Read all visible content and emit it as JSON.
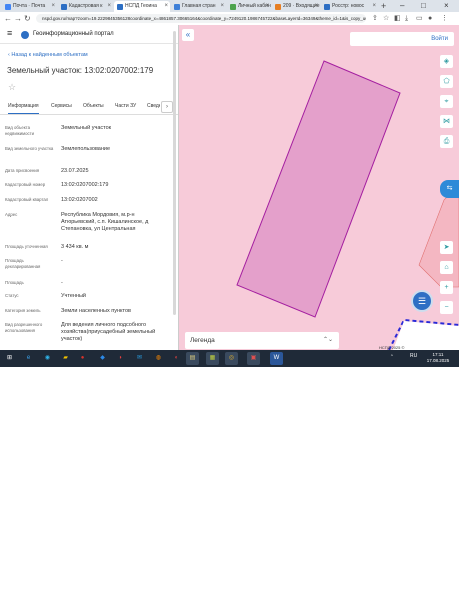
{
  "browser": {
    "tabs": [
      {
        "title": "Почта · Почта",
        "color": "#4285f4"
      },
      {
        "title": "Кадастровая к",
        "color": "#2d6fc4"
      },
      {
        "title": "НСПД Геоина",
        "color": "#2d6fc4"
      },
      {
        "title": "Главная стран",
        "color": "#3d7fd8"
      },
      {
        "title": "Личный кабин",
        "color": "#4da34d"
      },
      {
        "title": "209 · Входящие",
        "color": "#e67e22"
      },
      {
        "title": "Росстр: новос",
        "color": "#2d6fc4"
      }
    ],
    "new_tab": "+",
    "url": "nspd.gov.ru/map?zoom=19.2229845356128coordinate_x=4861857.30665164&coordinate_y=7249120.1986745722&baseLayerId=36349&theme_id=1&is_copy_url=true"
  },
  "portal": {
    "title": "Геоинформационный портал",
    "back_link": "Назад к найденным объектам",
    "heading": "Земельный участок: 13:02:0207002:179",
    "tabs": [
      "Информация",
      "Сервисы",
      "Объекты",
      "Части ЗУ",
      "Сведения"
    ],
    "next_tab": "›",
    "fields": [
      {
        "label": "Вид объекта недвижимости",
        "value": "Земельный участок"
      },
      {
        "label": "Вид земельного участка",
        "value": "Землепользование"
      },
      {
        "label": "Дата присвоения",
        "value": "23.07.2025"
      },
      {
        "label": "Кадастровый номер",
        "value": "13:02:0207002:179"
      },
      {
        "label": "Кадастровый квартал",
        "value": "13:02:0207002"
      },
      {
        "label": "Адрес",
        "value": "Республика Мордовия, м.р-н Атюрьевский, с.п. Кишалинское, д Степановка, ул Центральная"
      },
      {
        "label": "Площадь уточненная",
        "value": "3 434 кв. м"
      },
      {
        "label": "Площадь декларированная",
        "value": "-"
      },
      {
        "label": "Площадь",
        "value": "-"
      },
      {
        "label": "Статус",
        "value": "Учтенный"
      },
      {
        "label": "Категория земель",
        "value": "Земли населенных пунктов"
      },
      {
        "label": "Вид разрешенного использования",
        "value": "Для ведения личного подсобного хозяйства(приусадебный земельный участок)"
      }
    ]
  },
  "map": {
    "collapse_icon": "«",
    "login": "Войти",
    "legend": "Легенда",
    "legend_icon": "⌃⌄",
    "attribution": "НСПД 2025 ©",
    "parcel_fill": "#e4a0cb",
    "parcel_stroke": "#a41fa0",
    "background": "#f7cbd9"
  },
  "taskbar": {
    "lang": "RU",
    "time": "17:11",
    "date": "17.08.2025"
  }
}
